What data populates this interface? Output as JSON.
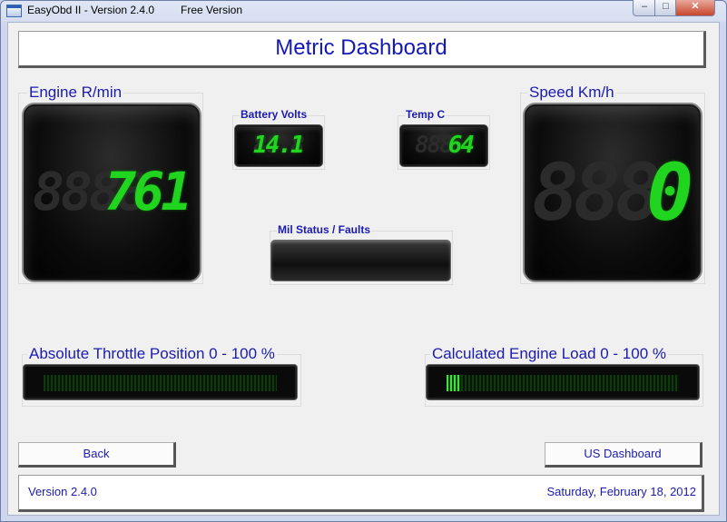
{
  "window": {
    "title": "EasyObd II - Version 2.4.0",
    "edition": "Free Version",
    "min_glyph": "–",
    "max_glyph": "□",
    "close_glyph": "✕"
  },
  "header": {
    "title": "Metric Dashboard"
  },
  "gauges": {
    "rpm": {
      "label": "Engine R/min",
      "ghost": "8888",
      "value": "761"
    },
    "volts": {
      "label": "Battery Volts",
      "ghost": "88.8",
      "value": "14.1"
    },
    "temp": {
      "label": "Temp C",
      "ghost": "888",
      "value": "64"
    },
    "speed": {
      "label": "Speed Km/h",
      "ghost": "888",
      "value": "0"
    }
  },
  "mil": {
    "label": "Mil Status / Faults",
    "value": ""
  },
  "throttle": {
    "label": "Absolute Throttle Position 0 - 100 %",
    "percent": 0
  },
  "load": {
    "label": "Calculated Engine Load 0 - 100 %",
    "percent": 6
  },
  "buttons": {
    "back": "Back",
    "us_dashboard": "US Dashboard"
  },
  "status": {
    "version": "Version 2.4.0",
    "date": "Saturday, February 18, 2012"
  },
  "colors": {
    "label": "#1b1bb0",
    "title": "#1418b8",
    "lcd_on": "#21d41f",
    "lcd_off": "#2b2b2b"
  },
  "icons": {
    "app": "app-window-icon"
  }
}
